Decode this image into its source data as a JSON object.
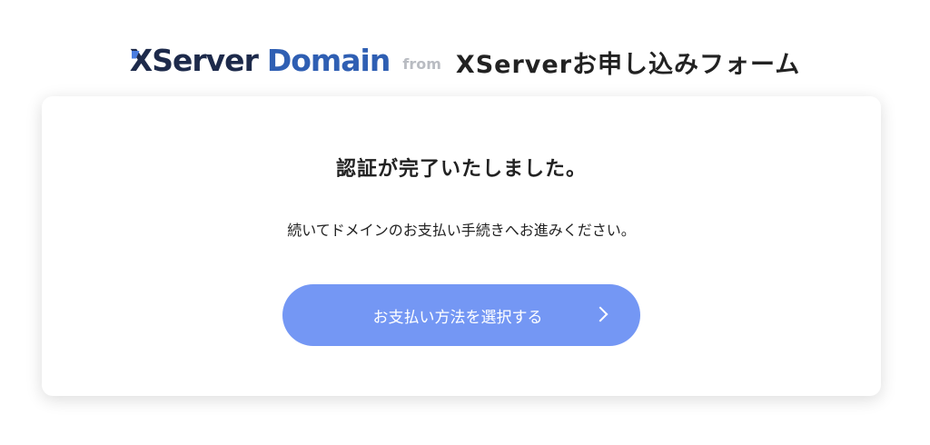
{
  "header": {
    "logo_x": "X",
    "logo_server": "Server",
    "logo_domain": "Domain",
    "from": "from",
    "form_title": "XServerお申し込みフォーム"
  },
  "card": {
    "heading": "認証が完了いたしました。",
    "message": "続いてドメインのお支払い手続きへお進みください。",
    "button_label": "お支払い方法を選択する"
  },
  "colors": {
    "logo_dark": "#1d2a4b",
    "logo_blue": "#2f5fb3",
    "button": "#7497f4"
  },
  "icons": {
    "button_icon": "chevron-right-icon"
  }
}
